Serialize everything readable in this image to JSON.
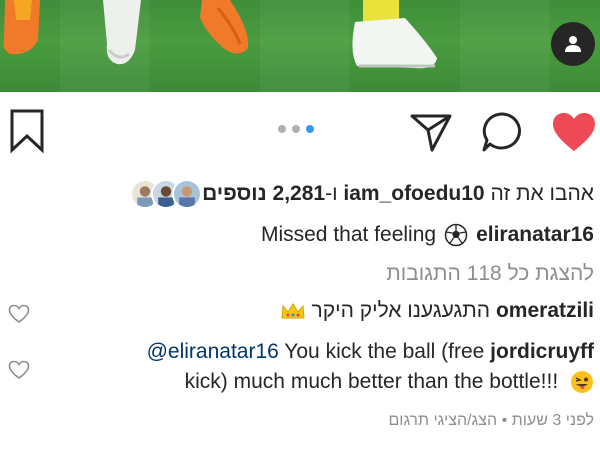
{
  "post": {
    "likes": {
      "prefix": "אהבו את זה",
      "user": "iam_ofoedu10",
      "conjunction": "ו-",
      "count": "2,281",
      "suffix": "נוספים"
    },
    "caption": {
      "username": "eliranatar16",
      "text": "Missed that feeling"
    },
    "view_all_comments": "להצגת כל 118 התגובות",
    "comments": [
      {
        "username": "omeratzili",
        "text": "התגעגענו אליק היקר"
      },
      {
        "username": "jordicruyff",
        "mention": "@eliranatar16",
        "text_line1": "You kick the ball (free",
        "text_line2": "kick) much much better than the bottle!!!"
      }
    ],
    "timestamp": "לפני 3 שעות",
    "separator": "•",
    "translate": "הצג/הציגי תרגום",
    "carousel": {
      "count": 3,
      "active_index": 2
    }
  },
  "colors": {
    "like_red": "#ed4956",
    "carousel_active": "#3897f0",
    "grass": "#4a9c3f",
    "secondary_text": "#8e8e8e"
  },
  "icons": {
    "like": "heart-filled-icon",
    "comment": "comment-bubble-icon",
    "share": "paper-plane-icon",
    "save": "bookmark-icon",
    "tag": "user-tag-icon",
    "comment_like": "heart-outline-icon"
  }
}
